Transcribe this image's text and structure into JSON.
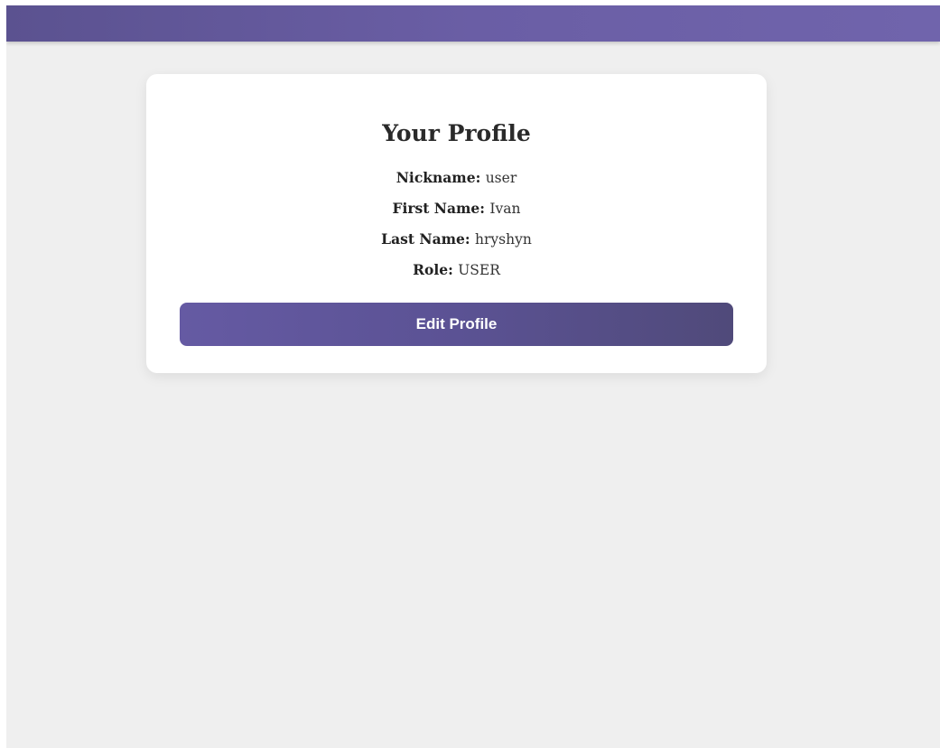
{
  "header": {
    "gradient_start": "#5b5290",
    "gradient_end": "#7064ac"
  },
  "profile": {
    "title": "Your Profile",
    "fields": [
      {
        "label": "Nickname:",
        "value": "user"
      },
      {
        "label": "First Name:",
        "value": "Ivan"
      },
      {
        "label": "Last Name:",
        "value": "hryshyn"
      },
      {
        "label": "Role:",
        "value": "USER"
      }
    ],
    "edit_button_label": "Edit Profile",
    "button_color": "#5b5294"
  }
}
